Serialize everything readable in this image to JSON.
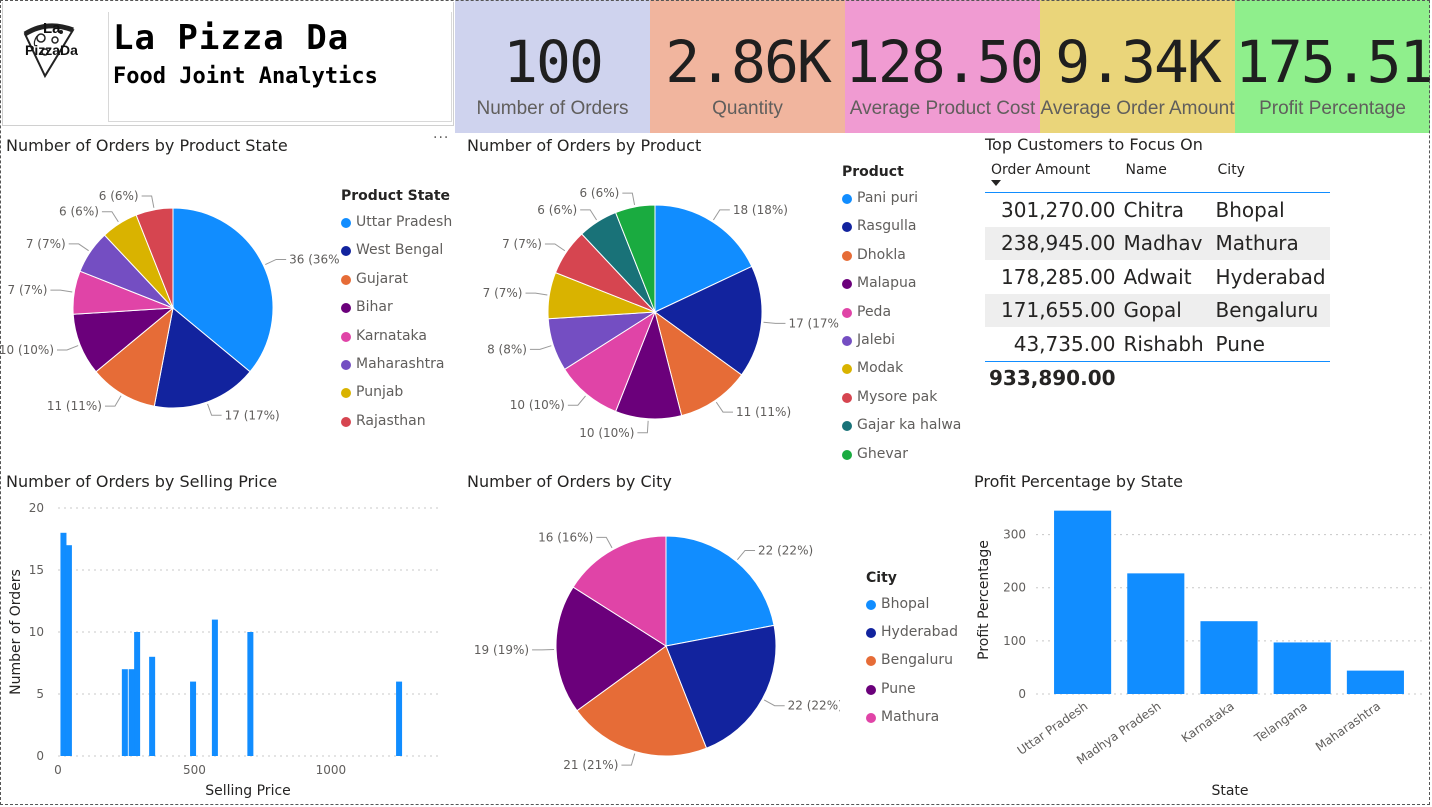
{
  "brand": {
    "logo_line1": "La",
    "logo_line2": "PizzaDa",
    "title": "La Pizza Da",
    "subtitle": "Food Joint Analytics"
  },
  "kpis": [
    {
      "value": "100",
      "label": "Number of Orders",
      "color": "#cfd3ee"
    },
    {
      "value": "2.86K",
      "label": "Quantity",
      "color": "#f1b59e"
    },
    {
      "value": "128.50",
      "label": "Average Product Cost",
      "color": "#f09bd2"
    },
    {
      "value": "9.34K",
      "label": "Average Order Amount",
      "color": "#ead57a"
    },
    {
      "value": "175.51",
      "label": "Profit Percentage",
      "color": "#8fef8c"
    }
  ],
  "more_options": "···",
  "top_customers": {
    "title": "Top Customers to Focus On",
    "columns": [
      "Order Amount",
      "Name",
      "City"
    ],
    "rows": [
      [
        "301,270.00",
        "Chitra",
        "Bhopal"
      ],
      [
        "238,945.00",
        "Madhav",
        "Mathura"
      ],
      [
        "178,285.00",
        "Adwait",
        "Hyderabad"
      ],
      [
        "171,655.00",
        "Gopal",
        "Bengaluru"
      ],
      [
        "43,735.00",
        "Rishabh",
        "Pune"
      ]
    ],
    "total": "933,890.00"
  },
  "chart_data": [
    {
      "type": "pie",
      "title": "Number of Orders by Product State",
      "legend_title": "Product State",
      "labels": [
        "Uttar Pradesh",
        "West Bengal",
        "Gujarat",
        "Bihar",
        "Karnataka",
        "Maharashtra",
        "Punjab",
        "Rajasthan"
      ],
      "values": [
        36,
        17,
        11,
        10,
        7,
        7,
        6,
        6
      ],
      "data_labels": [
        "36 (36%)",
        "17 (17%)",
        "11 (11%)",
        "10 (10%)",
        "7 (7%)",
        "7 (7%)",
        "6 (6%)",
        "6 (6%)"
      ],
      "colors": [
        "#118dff",
        "#12239e",
        "#e66c37",
        "#6b007b",
        "#e044a7",
        "#744ec2",
        "#d9b300",
        "#d64550"
      ],
      "legend_position": "right"
    },
    {
      "type": "pie",
      "title": "Number of Orders by Product",
      "legend_title": "Product",
      "labels": [
        "Pani puri",
        "Rasgulla",
        "Dhokla",
        "Malapua",
        "Peda",
        "Jalebi",
        "Modak",
        "Mysore pak",
        "Gajar ka halwa",
        "Ghevar"
      ],
      "values": [
        18,
        17,
        11,
        10,
        10,
        8,
        7,
        7,
        6,
        6
      ],
      "data_labels": [
        "18 (18%)",
        "17 (17%)",
        "11 (11%)",
        "10 (10%)",
        "10 (10%)",
        "8 (8%)",
        "7 (7%)",
        "7 (7%)",
        "6 (6%)",
        "6 (6%)"
      ],
      "colors": [
        "#118dff",
        "#12239e",
        "#e66c37",
        "#6b007b",
        "#e044a7",
        "#744ec2",
        "#d9b300",
        "#d64550",
        "#197278",
        "#1aab40"
      ],
      "legend_position": "right"
    },
    {
      "type": "bar",
      "title": "Number of Orders by Selling Price",
      "xlabel": "Selling Price",
      "ylabel": "Number of Orders",
      "x": [
        20,
        40,
        245,
        270,
        290,
        345,
        495,
        575,
        705,
        1250
      ],
      "values": [
        18,
        17,
        7,
        7,
        10,
        8,
        6,
        11,
        10,
        6
      ],
      "xlim": [
        0,
        1400
      ],
      "ylim": [
        0,
        20
      ],
      "x_ticks": [
        "0",
        "500",
        "1000"
      ],
      "y_ticks": [
        "0",
        "5",
        "10",
        "15",
        "20"
      ],
      "color": "#118dff",
      "grid": true
    },
    {
      "type": "pie",
      "title": "Number of Orders by City",
      "legend_title": "City",
      "labels": [
        "Bhopal",
        "Hyderabad",
        "Bengaluru",
        "Pune",
        "Mathura"
      ],
      "values": [
        22,
        22,
        21,
        19,
        16
      ],
      "data_labels": [
        "22 (22%)",
        "22 (22%)",
        "21 (21%)",
        "19 (19%)",
        "16 (16%)"
      ],
      "colors": [
        "#118dff",
        "#12239e",
        "#e66c37",
        "#6b007b",
        "#e044a7"
      ],
      "legend_position": "right"
    },
    {
      "type": "bar",
      "title": "Profit Percentage by State",
      "xlabel": "State",
      "ylabel": "Profit Percentage",
      "categories": [
        "Uttar Pradesh",
        "Madhya Pradesh",
        "Karnataka",
        "Telangana",
        "Maharashtra"
      ],
      "values": [
        345,
        227,
        137,
        97,
        44
      ],
      "ylim": [
        0,
        350
      ],
      "y_ticks": [
        "0",
        "100",
        "200",
        "300"
      ],
      "color": "#118dff",
      "grid": true
    }
  ]
}
